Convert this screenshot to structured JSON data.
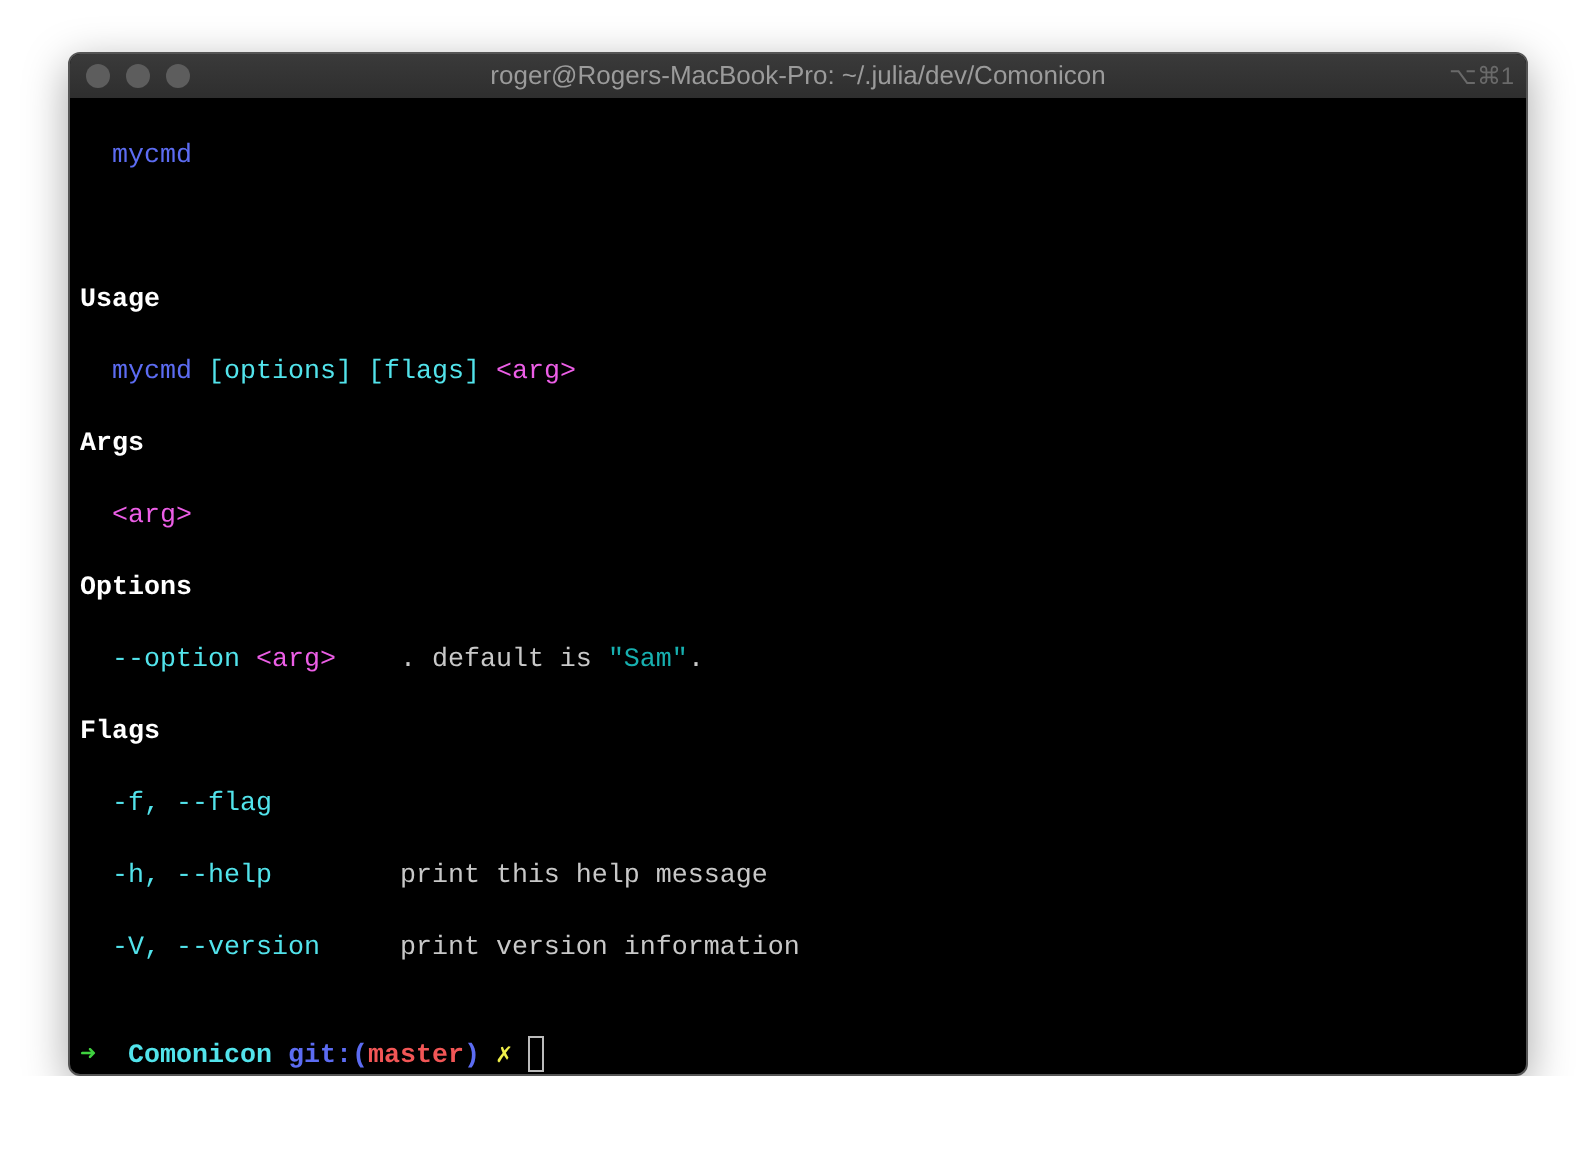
{
  "window": {
    "title": "roger@Rogers-MacBook-Pro: ~/.julia/dev/Comonicon",
    "shortcut": "⌥⌘1"
  },
  "terminal": {
    "lines": [
      {
        "kind": "title",
        "segments": [
          {
            "text": "mycmd",
            "kind": "command"
          }
        ]
      },
      {
        "kind": "heading",
        "text": "Usage"
      },
      {
        "kind": "entry",
        "segments": [
          {
            "text": "mycmd",
            "kind": "command"
          },
          {
            "text": "[options]",
            "kind": "option"
          },
          {
            "text": "[flags]",
            "kind": "option"
          },
          {
            "text": "<arg>",
            "kind": "arg"
          }
        ]
      },
      {
        "kind": "heading",
        "text": "Args"
      },
      {
        "kind": "entry",
        "segments": [
          {
            "text": "<arg>",
            "kind": "arg"
          }
        ]
      },
      {
        "kind": "heading",
        "text": "Options"
      },
      {
        "kind": "item",
        "name": [
          {
            "text": "--option",
            "kind": "option"
          },
          {
            "text": "<arg>",
            "kind": "arg"
          }
        ],
        "description": [
          {
            "text": ". default is ",
            "kind": "plain"
          },
          {
            "text": "\"Sam\"",
            "kind": "string"
          },
          {
            "text": ".",
            "kind": "plain"
          }
        ]
      },
      {
        "kind": "heading",
        "text": "Flags"
      },
      {
        "kind": "item",
        "name": [
          {
            "text": "-f, --flag",
            "kind": "option"
          }
        ]
      },
      {
        "kind": "item",
        "name": [
          {
            "text": "-h, --help",
            "kind": "option"
          }
        ],
        "description": [
          {
            "text": "print this help message",
            "kind": "plain"
          }
        ]
      },
      {
        "kind": "item",
        "name": [
          {
            "text": "-V, --version",
            "kind": "option"
          }
        ],
        "description": [
          {
            "text": "print version information",
            "kind": "plain"
          }
        ]
      }
    ]
  },
  "prompt": {
    "arrow": "➜",
    "directory": "Comonicon",
    "git_open": "git:(",
    "branch": "master",
    "git_close": ")",
    "dirty_mark": "✗"
  }
}
